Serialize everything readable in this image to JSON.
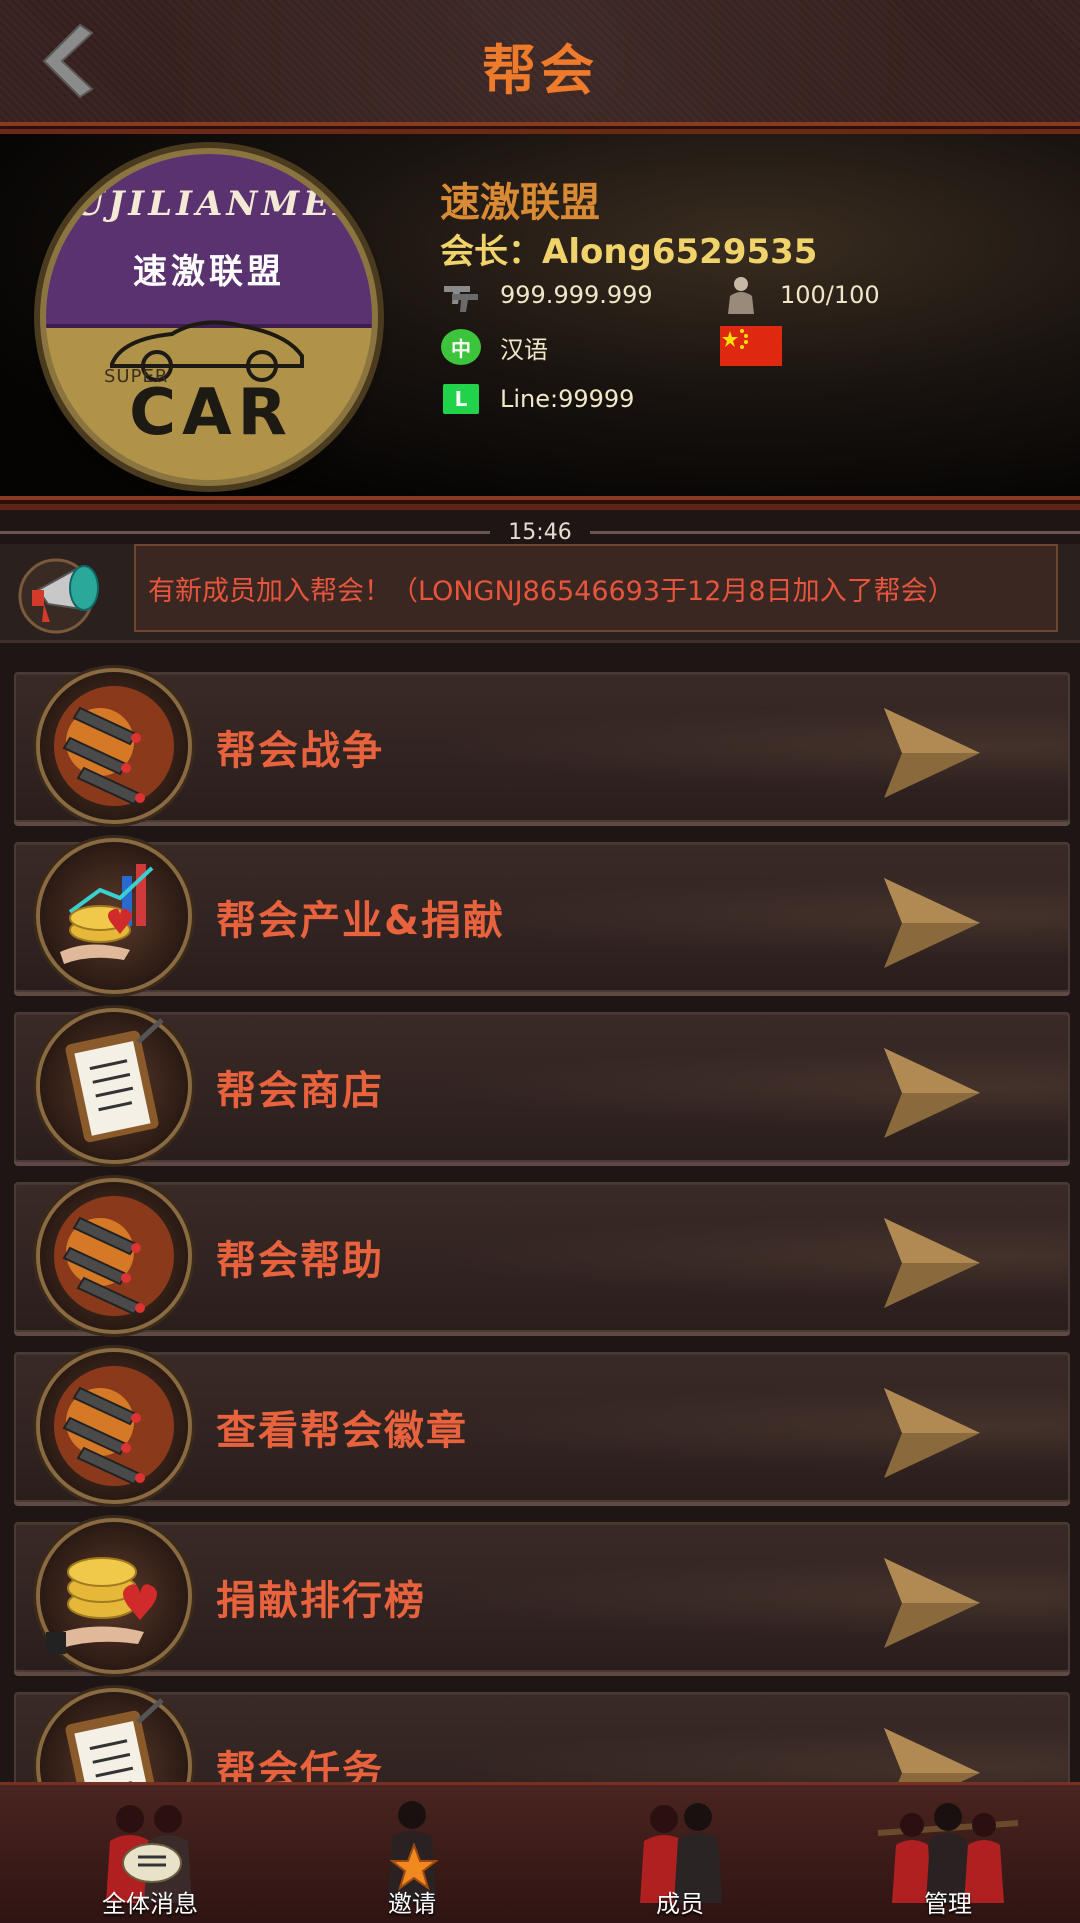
{
  "header": {
    "title": "帮会"
  },
  "guild": {
    "emblem": {
      "pinyin": "SUJILIANMENG",
      "chinese": "速激联盟",
      "super": "SUPER",
      "car": "CAR"
    },
    "name": "速激联盟",
    "leader": "会长：Along6529535",
    "power": "999.999.999",
    "members": "100/100",
    "language": "汉语",
    "language_badge": "中",
    "line_badge": "L",
    "line_id": "Line:99999",
    "country_flag": "china-flag"
  },
  "time": "15:46",
  "news": {
    "text": "有新成员加入帮会！（LONGNJ86546693于12月8日加入了帮会）"
  },
  "menu": [
    {
      "label": "帮会战争",
      "icon": "missiles-icon"
    },
    {
      "label": "帮会产业&捐献",
      "icon": "coins-chart-icon"
    },
    {
      "label": "帮会商店",
      "icon": "clipboard-icon"
    },
    {
      "label": "帮会帮助",
      "icon": "missiles-icon"
    },
    {
      "label": "查看帮会徽章",
      "icon": "missiles-icon"
    },
    {
      "label": "捐献排行榜",
      "icon": "coins-heart-icon"
    },
    {
      "label": "帮会任务",
      "icon": "clipboard-icon"
    }
  ],
  "bottom_nav": [
    {
      "label": "全体消息",
      "icon": "chat-bubble-icon"
    },
    {
      "label": "邀请",
      "icon": "star-icon"
    },
    {
      "label": "成员",
      "icon": "members-icon"
    },
    {
      "label": "管理",
      "icon": "management-icon"
    }
  ],
  "colors": {
    "accent": "#ee7a2c",
    "menu_text": "#e8623e",
    "leader_text": "#f0d36a",
    "news_text": "#e6553c"
  }
}
